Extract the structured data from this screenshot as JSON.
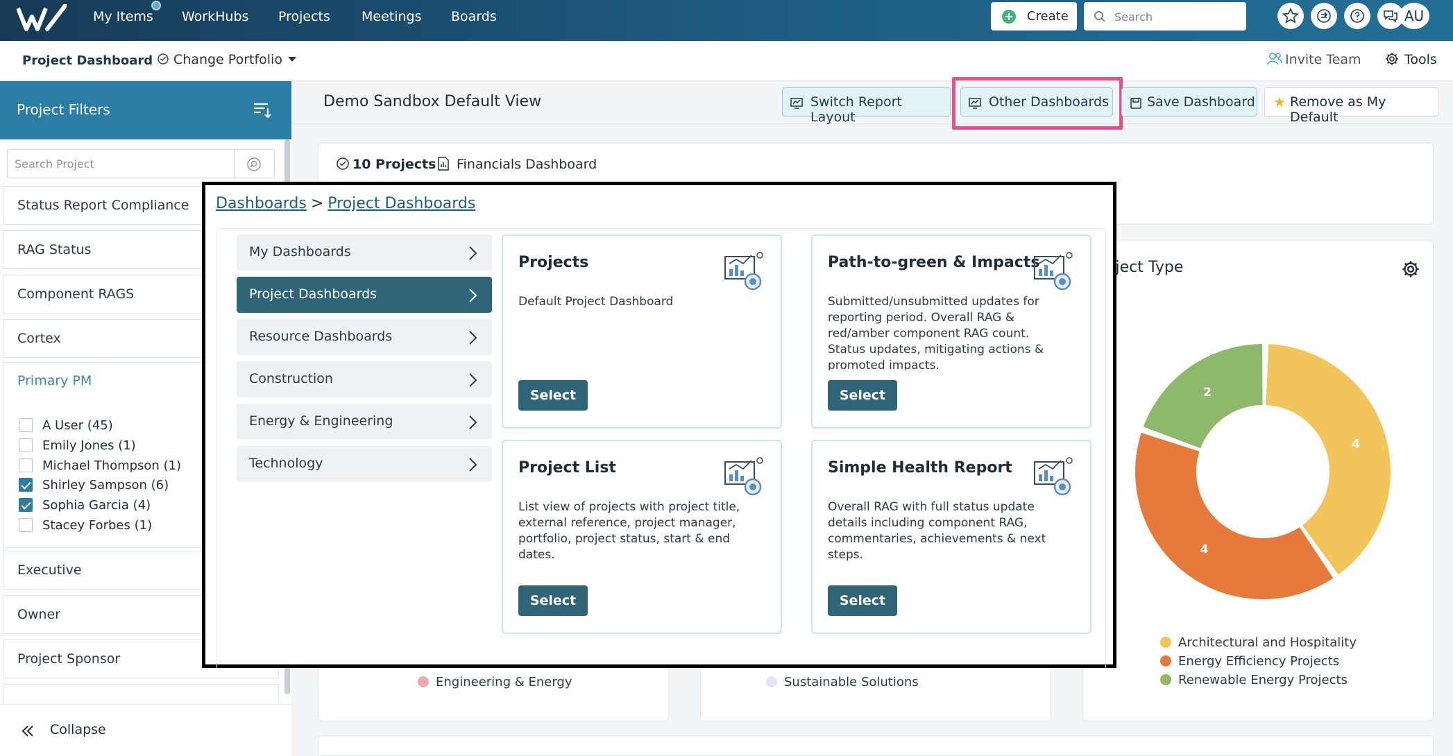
{
  "topbar": {
    "nav": [
      "My Items",
      "WorkHubs",
      "Projects",
      "Meetings",
      "Boards"
    ],
    "create_label": "Create",
    "search_placeholder": "Search",
    "avatar_initials": "AU"
  },
  "subbar": {
    "project_dashboard": "Project Dashboard",
    "change_portfolio": "Change Portfolio",
    "invite_team": "Invite Team",
    "tools": "Tools"
  },
  "sidebar": {
    "title": "Project Filters",
    "search_placeholder": "Search Project",
    "filters_top": [
      "Status Report Compliance",
      "RAG Status",
      "Component RAGS",
      "Cortex"
    ],
    "primary_pm": {
      "label": "Primary PM",
      "people": [
        {
          "name": "A User",
          "count": "(45)",
          "checked": false
        },
        {
          "name": "Emily Jones",
          "count": "(1)",
          "checked": false
        },
        {
          "name": "Michael Thompson",
          "count": "(1)",
          "checked": false
        },
        {
          "name": "Shirley Sampson",
          "count": "(6)",
          "checked": true
        },
        {
          "name": "Sophia Garcia",
          "count": "(4)",
          "checked": true
        },
        {
          "name": "Stacey Forbes",
          "count": "(1)",
          "checked": false
        }
      ]
    },
    "filters_bottom": [
      "Executive",
      "Owner",
      "Project Sponsor"
    ],
    "collapse_label": "Collapse"
  },
  "main": {
    "view_title": "Demo Sandbox Default View",
    "switch_layout": "Switch Report Layout",
    "other_dashboards": "Other Dashboards",
    "save_dashboard": "Save Dashboard",
    "remove_default": "Remove as My Default",
    "project_count": "10 Projects",
    "financials_dashboard": "Financials Dashboard",
    "legend_left": "Engineering & Energy",
    "legend_mid": "Sustainable Solutions",
    "donut_title": "oject Type",
    "donut_legend": [
      {
        "label": "Architectural and Hospitality",
        "color": "#f2c55c"
      },
      {
        "label": "Energy Efficiency Projects",
        "color": "#e57a3c"
      },
      {
        "label": "Renewable Energy Projects",
        "color": "#8fb96a"
      }
    ]
  },
  "chart_data": {
    "type": "pie",
    "categories": [
      "Architectural and Hospitality",
      "Energy Efficiency Projects",
      "Renewable Energy Projects"
    ],
    "values": [
      4,
      4,
      2
    ],
    "colors": [
      "#f2c55c",
      "#e57a3c",
      "#8fb96a"
    ],
    "title": "",
    "legend": "bottom"
  },
  "modal": {
    "crumb_root": "Dashboards",
    "crumb_sep": ">",
    "crumb_current": "Project Dashboards",
    "categories": [
      {
        "label": "My Dashboards",
        "active": false
      },
      {
        "label": "Project Dashboards",
        "active": true
      },
      {
        "label": "Resource Dashboards",
        "active": false
      },
      {
        "label": "Construction",
        "active": false
      },
      {
        "label": "Energy & Engineering",
        "active": false
      },
      {
        "label": "Technology",
        "active": false
      }
    ],
    "cards": [
      {
        "title": "Projects",
        "desc": "Default Project Dashboard",
        "button": "Select"
      },
      {
        "title": "Path-to-green & Impacts",
        "desc": "Submitted/unsubmitted updates for reporting period. Overall RAG & red/amber component RAG count. Status updates, mitigating actions & promoted impacts.",
        "button": "Select"
      },
      {
        "title": "Project List",
        "desc": "List view of projects with project title, external reference, project manager, portfolio, project status, start & end dates.",
        "button": "Select"
      },
      {
        "title": "Simple Health Report",
        "desc": "Overall RAG with full status update details including component RAG, commentaries, achievements & next steps.",
        "button": "Select"
      }
    ]
  }
}
